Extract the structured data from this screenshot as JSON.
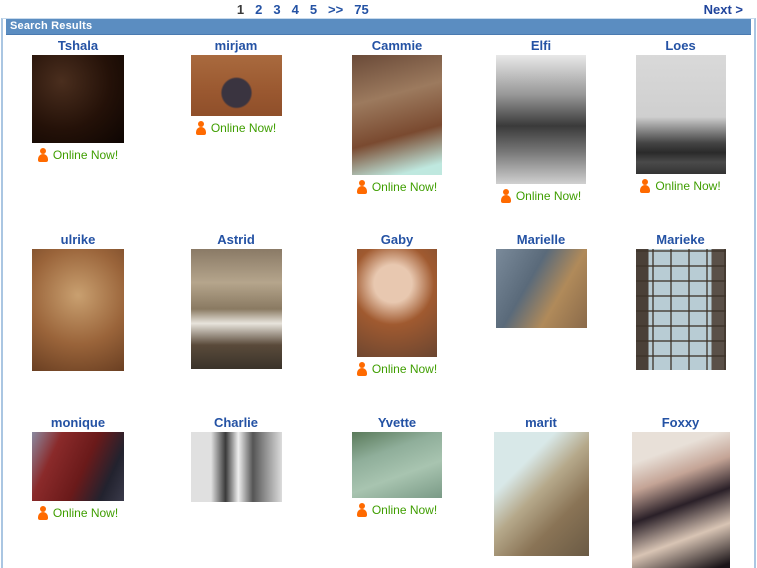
{
  "pagination": {
    "current_page": "1",
    "pages": [
      "2",
      "3",
      "4",
      "5"
    ],
    "skip_label": ">>",
    "last_page": "75",
    "next_label": "Next >"
  },
  "header": {
    "title": "Search Results"
  },
  "labels": {
    "online_now": "Online Now!"
  },
  "colors": {
    "header_bar": "#5b8dc1",
    "frame_border": "#aac6e2",
    "name_link_blue": "#2452a4",
    "online_green": "#3f9e00",
    "online_icon_orange": "#ff6a00"
  },
  "profiles": [
    {
      "name": "Tshala",
      "online": true
    },
    {
      "name": "mirjam",
      "online": true
    },
    {
      "name": "Cammie",
      "online": true
    },
    {
      "name": "Elfi",
      "online": true
    },
    {
      "name": "Loes",
      "online": true
    },
    {
      "name": "ulrike",
      "online": false
    },
    {
      "name": "Astrid",
      "online": false
    },
    {
      "name": "Gaby",
      "online": true
    },
    {
      "name": "Marielle",
      "online": false
    },
    {
      "name": "Marieke",
      "online": false
    },
    {
      "name": "monique",
      "online": true
    },
    {
      "name": "Charlie",
      "online": false
    },
    {
      "name": "Yvette",
      "online": true
    },
    {
      "name": "marit",
      "online": false
    },
    {
      "name": "Foxxy",
      "online": false
    }
  ]
}
